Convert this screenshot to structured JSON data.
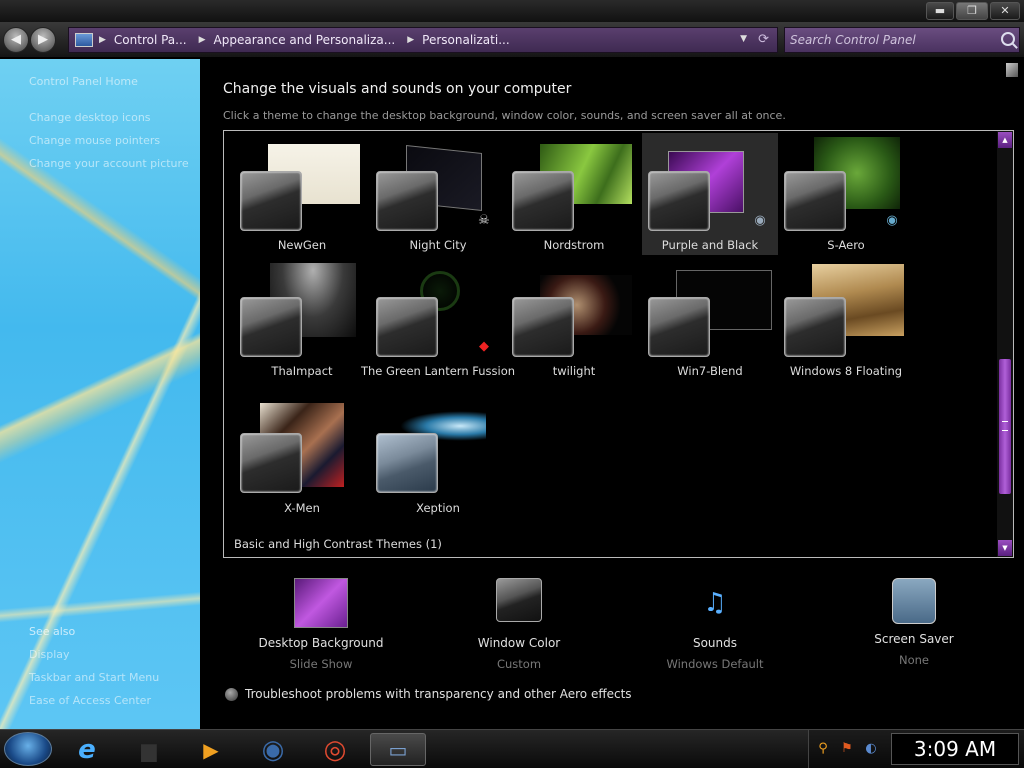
{
  "window": {
    "minimize_label": "▬",
    "maximize_label": "❐",
    "close_label": "✕"
  },
  "address_bar": {
    "breadcrumbs": [
      "Control Pa...",
      "Appearance and Personaliza...",
      "Personalizati..."
    ],
    "search_placeholder": "Search Control Panel",
    "refresh_glyph": "⟳",
    "dropdown_glyph": "▼"
  },
  "left_pane": {
    "home": "Control Panel Home",
    "links": [
      "Change desktop icons",
      "Change mouse pointers",
      "Change your account picture"
    ],
    "see_also": "See also",
    "see_also_links": [
      "Display",
      "Taskbar and Start Menu",
      "Ease of Access Center"
    ]
  },
  "main": {
    "heading": "Change the visuals and sounds on your computer",
    "subheading": "Click a theme to change the desktop background, window color, sounds, and screen saver all at once.",
    "themes": [
      {
        "label": "NewGen",
        "icon": "",
        "selected": false
      },
      {
        "label": "Night City",
        "icon": "skull-icon",
        "glyph": "☠",
        "selected": false
      },
      {
        "label": "Nordstrom",
        "icon": "",
        "selected": false
      },
      {
        "label": "Purple and Black",
        "icon": "alien-icon",
        "glyph": "◉",
        "selected": true
      },
      {
        "label": "S-Aero",
        "icon": "globe-icon",
        "glyph": "◉",
        "selected": false
      },
      {
        "label": "ThaImpact",
        "icon": "",
        "selected": false
      },
      {
        "label": "The Green Lantern Fussion",
        "icon": "badge-icon",
        "glyph": "◆",
        "selected": false
      },
      {
        "label": "twilight",
        "icon": "",
        "selected": false
      },
      {
        "label": "Win7-Blend",
        "icon": "",
        "selected": false
      },
      {
        "label": "Windows 8 Floating",
        "icon": "",
        "selected": false
      },
      {
        "label": "X-Men",
        "icon": "",
        "selected": false
      },
      {
        "label": "Xeption",
        "icon": "",
        "selected": false
      }
    ],
    "basic_themes_label": "Basic and High Contrast Themes (1)",
    "settings": [
      {
        "label": "Desktop Background",
        "value": "Slide Show",
        "icon": "desktop-background-icon"
      },
      {
        "label": "Window Color",
        "value": "Custom",
        "icon": "window-color-icon"
      },
      {
        "label": "Sounds",
        "value": "Windows Default",
        "icon": "sounds-icon"
      },
      {
        "label": "Screen Saver",
        "value": "None",
        "icon": "screen-saver-icon"
      }
    ],
    "troubleshoot": "Troubleshoot problems with transparency and other Aero effects"
  },
  "taskbar": {
    "clock": "3:09 AM",
    "apps": [
      {
        "name": "internet-explorer-icon",
        "glyph": "e"
      },
      {
        "name": "folder-icon",
        "glyph": "▆"
      },
      {
        "name": "media-player-icon",
        "glyph": "▶"
      },
      {
        "name": "globe-app-icon",
        "glyph": "◉"
      },
      {
        "name": "chrome-icon",
        "glyph": "◎"
      },
      {
        "name": "control-panel-app-icon",
        "glyph": "▭"
      }
    ],
    "tray": [
      {
        "name": "search-tray-icon",
        "glyph": "⚲"
      },
      {
        "name": "flag-tray-icon",
        "glyph": "⚑"
      },
      {
        "name": "network-tray-icon",
        "glyph": "◐"
      }
    ]
  },
  "colors": {
    "accent_purple": "#7a2ea0",
    "address_purple": "#5a3f6e",
    "sidebar_blue": "#43b9ee"
  }
}
